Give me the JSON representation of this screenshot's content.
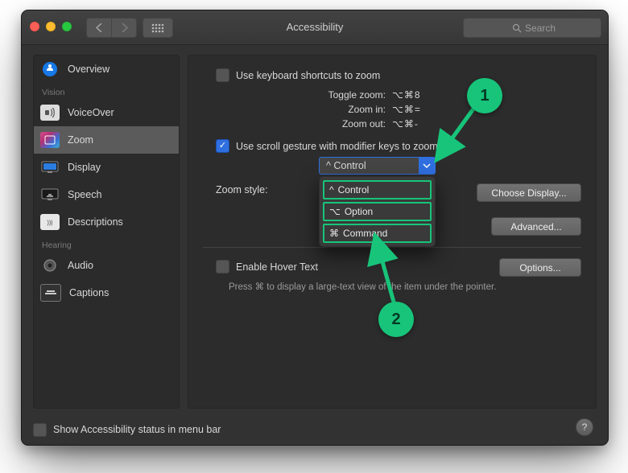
{
  "window": {
    "title": "Accessibility"
  },
  "toolbar": {
    "search_placeholder": "Search"
  },
  "sidebar": {
    "headings": {
      "vision": "Vision",
      "hearing": "Hearing"
    },
    "items": [
      {
        "label": "Overview"
      },
      {
        "label": "VoiceOver"
      },
      {
        "label": "Zoom"
      },
      {
        "label": "Display"
      },
      {
        "label": "Speech"
      },
      {
        "label": "Descriptions"
      },
      {
        "label": "Audio"
      },
      {
        "label": "Captions"
      }
    ],
    "selected_index": 2
  },
  "zoom": {
    "kb_checkbox_label": "Use keyboard shortcuts to zoom",
    "shortcuts": {
      "toggle": {
        "label": "Toggle zoom:",
        "keys": "⌥⌘8"
      },
      "in": {
        "label": "Zoom in:",
        "keys": "⌥⌘="
      },
      "out": {
        "label": "Zoom out:",
        "keys": "⌥⌘-"
      }
    },
    "scroll_checkbox_label": "Use scroll gesture with modifier keys to zoom:",
    "modifier_selected": "^ Control",
    "modifier_options": [
      {
        "label": "Control",
        "sym": "^"
      },
      {
        "label": "Option",
        "sym": "⌥"
      },
      {
        "label": "Command",
        "sym": "⌘"
      }
    ],
    "zoom_style_label": "Zoom style:",
    "choose_display_btn": "Choose Display...",
    "advanced_btn": "Advanced...",
    "hover_checkbox_label": "Enable Hover Text",
    "hover_options_btn": "Options...",
    "hover_hint": "Press ⌘ to display a large-text view of the item under the pointer."
  },
  "footer": {
    "status_label": "Show Accessibility status in menu bar",
    "help": "?"
  },
  "annotations": {
    "badge1": "1",
    "badge2": "2"
  }
}
